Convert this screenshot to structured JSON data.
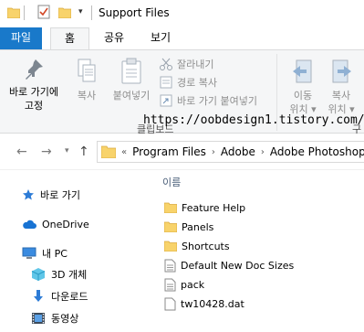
{
  "window": {
    "title": "Support Files"
  },
  "ribbon_tabs": [
    {
      "label": "파일"
    },
    {
      "label": "홈"
    },
    {
      "label": "공유"
    },
    {
      "label": "보기"
    }
  ],
  "ribbon": {
    "pin": {
      "label_line1": "바로 가기에",
      "label_line2": "고정"
    },
    "copy": {
      "label": "복사"
    },
    "paste": {
      "label": "붙여넣기"
    },
    "cut": {
      "label": "잘라내기"
    },
    "copy_path": {
      "label": "경로 복사"
    },
    "paste_shortcut": {
      "label": "바로 가기 붙여넣기"
    },
    "move_to": {
      "label_line1": "이동",
      "label_line2": "위치 ▾"
    },
    "copy_to": {
      "label_line1": "복사",
      "label_line2": "위치 ▾"
    },
    "clipboard_group": "클립보드",
    "organize_group_char": "구"
  },
  "watermark": "https://oobdesign1.tistory.com/",
  "address": {
    "overflow": "«",
    "crumbs": [
      "Program Files",
      "Adobe",
      "Adobe Photoshop"
    ]
  },
  "navpane": {
    "items": [
      {
        "label": "바로 가기"
      },
      {
        "label": "OneDrive"
      },
      {
        "label": "내 PC"
      },
      {
        "label": "3D 개체"
      },
      {
        "label": "다운로드"
      },
      {
        "label": "동영상"
      }
    ]
  },
  "filelist": {
    "column_name": "이름",
    "items": [
      {
        "name": "Feature Help",
        "icon": "folder-icon"
      },
      {
        "name": "Panels",
        "icon": "folder-icon"
      },
      {
        "name": "Shortcuts",
        "icon": "folder-icon"
      },
      {
        "name": "Default New Doc Sizes",
        "icon": "text-file-icon"
      },
      {
        "name": "pack",
        "icon": "text-file-icon"
      },
      {
        "name": "tw10428.dat",
        "icon": "dat-file-icon"
      }
    ]
  },
  "colors": {
    "file_tab": "#1979ca",
    "folder": "#f8d36b",
    "ribbon_bg": "#f5f6f7"
  }
}
